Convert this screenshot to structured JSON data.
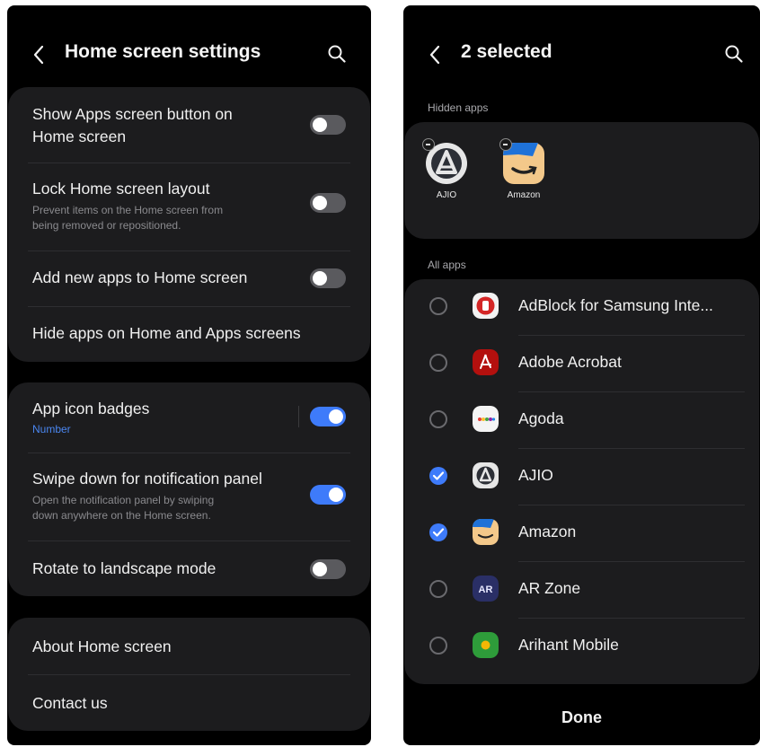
{
  "left": {
    "header": {
      "title": "Home screen settings",
      "back_icon": "chevron-left-icon",
      "search_icon": "search-icon"
    },
    "group1": [
      {
        "line1": "Show Apps screen button on",
        "line2": "Home screen",
        "toggle": "off"
      },
      {
        "label": "Lock Home screen layout",
        "desc1": "Prevent items on the Home screen from",
        "desc2": "being removed or repositioned.",
        "toggle": "off"
      },
      {
        "label": "Add new apps to Home screen",
        "toggle": "off"
      },
      {
        "label": "Hide apps on Home and Apps screens"
      }
    ],
    "group2": [
      {
        "label": "App icon badges",
        "sub": "Number",
        "toggle": "on"
      },
      {
        "label": "Swipe down for notification panel",
        "desc1": "Open the notification panel by swiping",
        "desc2": "down anywhere on the Home screen.",
        "toggle": "on"
      },
      {
        "label": "Rotate to landscape mode",
        "toggle": "off"
      }
    ],
    "group3": [
      {
        "label": "About Home screen"
      },
      {
        "label": "Contact us"
      }
    ]
  },
  "right": {
    "header": {
      "title": "2 selected",
      "back_icon": "chevron-left-icon",
      "search_icon": "search-icon"
    },
    "hidden_label": "Hidden apps",
    "hidden_apps": [
      {
        "name": "AJIO",
        "icon": "ajio-icon"
      },
      {
        "name": "Amazon",
        "icon": "amazon-icon"
      }
    ],
    "all_label": "All apps",
    "apps": [
      {
        "name": "AdBlock for Samsung Inte...",
        "icon": "adblock-icon",
        "checked": false
      },
      {
        "name": "Adobe Acrobat",
        "icon": "acrobat-icon",
        "checked": false
      },
      {
        "name": "Agoda",
        "icon": "agoda-icon",
        "checked": false
      },
      {
        "name": "AJIO",
        "icon": "ajio-icon",
        "checked": true
      },
      {
        "name": "Amazon",
        "icon": "amazon-icon",
        "checked": true
      },
      {
        "name": "AR Zone",
        "icon": "ar-zone-icon",
        "icon_text": "AR",
        "checked": false
      },
      {
        "name": "Arihant Mobile",
        "icon": "arihant-icon",
        "checked": false
      }
    ],
    "done_label": "Done"
  },
  "colors": {
    "accent": "#3e7bfa",
    "card": "#1c1c1e",
    "background": "#000000",
    "toggle_off": "#5a5a5e"
  }
}
